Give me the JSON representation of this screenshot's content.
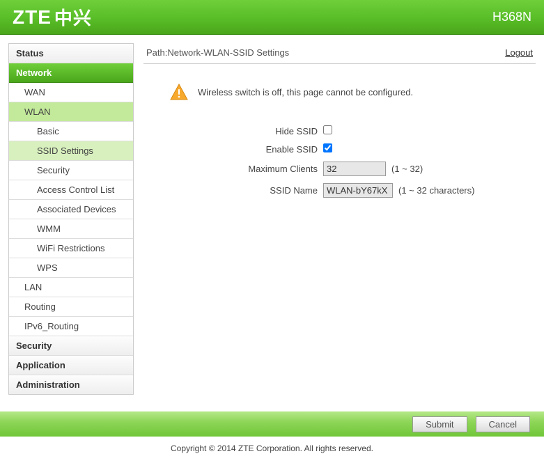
{
  "header": {
    "brand_en": "ZTE",
    "brand_cn": "中兴",
    "model": "H368N"
  },
  "path": {
    "label": "Path:Network-WLAN-SSID Settings",
    "logout": "Logout"
  },
  "warning": {
    "message": "Wireless switch is off, this page cannot be configured."
  },
  "form": {
    "hide_ssid": {
      "label": "Hide SSID",
      "checked": false
    },
    "enable_ssid": {
      "label": "Enable SSID",
      "checked": true
    },
    "max_clients": {
      "label": "Maximum Clients",
      "value": "32",
      "hint": "(1 ~ 32)"
    },
    "ssid_name": {
      "label": "SSID Name",
      "value": "WLAN-bY67kX",
      "hint": "(1 ~ 32 characters)"
    }
  },
  "buttons": {
    "submit": "Submit",
    "cancel": "Cancel"
  },
  "sidebar": {
    "status": "Status",
    "network": "Network",
    "wan": "WAN",
    "wlan": "WLAN",
    "basic": "Basic",
    "ssid_settings": "SSID Settings",
    "security": "Security",
    "acl": "Access Control List",
    "assoc": "Associated Devices",
    "wmm": "WMM",
    "wifi_restrict": "WiFi Restrictions",
    "wps": "WPS",
    "lan": "LAN",
    "routing": "Routing",
    "ipv6_routing": "IPv6_Routing",
    "security_top": "Security",
    "application": "Application",
    "administration": "Administration"
  },
  "footer": {
    "copyright": "Copyright © 2014 ZTE Corporation. All rights reserved."
  }
}
